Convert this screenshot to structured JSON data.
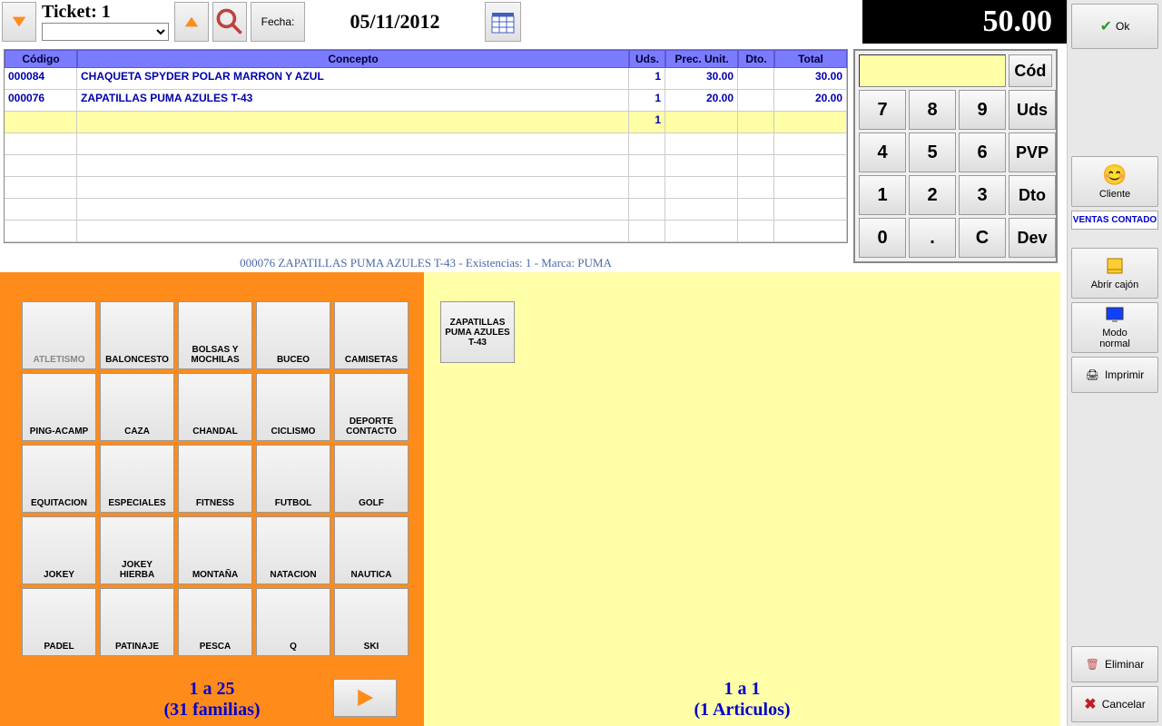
{
  "header": {
    "ticket_label": "Ticket: 1",
    "fecha_label": "Fecha:",
    "date": "05/11/2012",
    "total": "50.00"
  },
  "keypad": {
    "cod": "Cód",
    "uds": "Uds",
    "pvp": "PVP",
    "dto": "Dto",
    "dev": "Dev",
    "k7": "7",
    "k8": "8",
    "k9": "9",
    "k4": "4",
    "k5": "5",
    "k6": "6",
    "k1": "1",
    "k2": "2",
    "k3": "3",
    "k0": "0",
    "kdot": ".",
    "kc": "C"
  },
  "table": {
    "headers": {
      "codigo": "Código",
      "concepto": "Concepto",
      "uds": "Uds.",
      "pu": "Prec. Unit.",
      "dto": "Dto.",
      "total": "Total"
    },
    "rows": [
      {
        "codigo": "000084",
        "concepto": "CHAQUETA SPYDER POLAR MARRON Y AZUL",
        "uds": "1",
        "pu": "30.00",
        "dto": "",
        "total": "30.00"
      },
      {
        "codigo": "000076",
        "concepto": "ZAPATILLAS PUMA AZULES T-43",
        "uds": "1",
        "pu": "20.00",
        "dto": "",
        "total": "20.00"
      }
    ],
    "current_uds": "1"
  },
  "status": "000076 ZAPATILLAS PUMA AZULES T-43 - Existencias: 1 - Marca: PUMA",
  "families": {
    "items": [
      "ATLETISMO",
      "BALONCESTO",
      "BOLSAS Y MOCHILAS",
      "BUCEO",
      "CAMISETAS",
      "PING-ACAMP",
      "CAZA",
      "CHANDAL",
      "CICLISMO",
      "DEPORTE CONTACTO",
      "EQUITACION",
      "ESPECIALES",
      "FITNESS",
      "FUTBOL",
      "GOLF",
      "JOKEY",
      "JOKEY HIERBA",
      "MONTAÑA",
      "NATACION",
      "NAUTICA",
      "PADEL",
      "PATINAJE",
      "PESCA",
      "Q",
      "SKI"
    ],
    "pager_range": "1 a 25",
    "pager_total": "(31 familias)"
  },
  "articles": {
    "items": [
      "ZAPATILLAS PUMA AZULES T-43"
    ],
    "pager_range": "1 a 1",
    "pager_total": "(1 Articulos)"
  },
  "sidebar": {
    "ok": "Ok",
    "cliente": "Cliente",
    "ventas": "VENTAS CONTADO",
    "abrir": "Abrir cajón",
    "modo1": "Modo",
    "modo2": "normal",
    "imprimir": "Imprimir",
    "eliminar": "Eliminar",
    "cancelar": "Cancelar"
  }
}
